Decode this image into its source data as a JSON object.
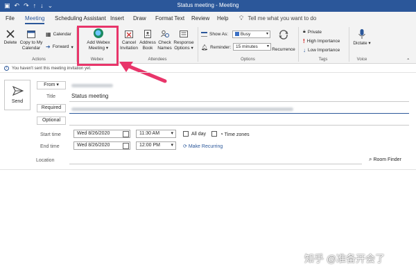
{
  "window": {
    "title": "Status meeting - Meeting"
  },
  "tabs": [
    "File",
    "Meeting",
    "Scheduling Assistant",
    "Insert",
    "Draw",
    "Format Text",
    "Review",
    "Help"
  ],
  "tell_me": "Tell me what you want to do",
  "ribbon": {
    "actions": {
      "delete": "Delete",
      "copy_to_my_calendar": "Copy to My Calendar",
      "calendar": "Calendar",
      "forward": "Forward",
      "label": "Actions"
    },
    "webex": {
      "add_meeting_l1": "Add Webex",
      "add_meeting_l2": "Meeting",
      "label": "Webex"
    },
    "attendees": {
      "cancel_l1": "Cancel",
      "cancel_l2": "Invitation",
      "address_l1": "Address",
      "address_l2": "Book",
      "check_l1": "Check",
      "check_l2": "Names",
      "response_l1": "Response",
      "response_l2": "Options",
      "label": "Attendees"
    },
    "options": {
      "show_as": "Show As:",
      "show_as_value": "Busy",
      "reminder": "Reminder:",
      "reminder_value": "15 minutes",
      "recurrence": "Recurrence",
      "label": "Options"
    },
    "tags": {
      "private": "Private",
      "high": "High Importance",
      "low": "Low Importance",
      "label": "Tags"
    },
    "voice": {
      "dictate": "Dictate",
      "label": "Voice"
    }
  },
  "info_bar": "You haven't sent this meeting invitation yet.",
  "form": {
    "send": "Send",
    "from": "From",
    "title_label": "Title",
    "title_value": "Status meeting",
    "required": "Required",
    "optional": "Optional",
    "start_time_label": "Start time",
    "start_date": "Wed 8/26/2020",
    "start_time": "11:30 AM",
    "all_day": "All day",
    "time_zones": "Time zones",
    "end_time_label": "End time",
    "end_date": "Wed 8/26/2020",
    "end_time": "12:00 PM",
    "make_recurring": "Make Recurring",
    "location_label": "Location",
    "room_finder": "Room Finder"
  },
  "watermark": "知乎 @准备开会了"
}
